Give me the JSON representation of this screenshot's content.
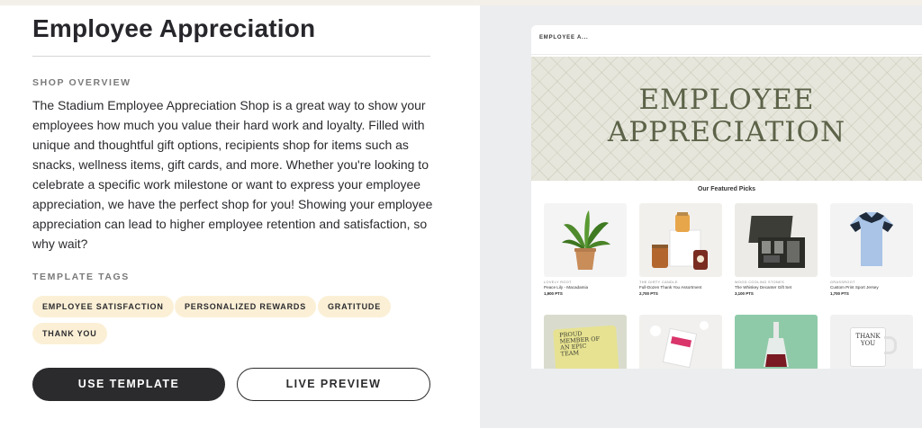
{
  "left": {
    "title": "Employee Appreciation",
    "overview_label": "SHOP OVERVIEW",
    "description": "The Stadium Employee Appreciation Shop is a great way to show your employees how much you value their hard work and loyalty. Filled with unique and thoughtful gift options, recipients shop for items such as snacks, wellness items, gift cards, and more. Whether you're looking to celebrate a specific work milestone or want to express your employee appreciation, we have the perfect shop for you! Showing your employee appreciation can lead to higher employee retention and satisfaction, so why wait?",
    "tags_label": "TEMPLATE TAGS",
    "tags": [
      "EMPLOYEE SATISFACTION",
      "PERSONALIZED REWARDS",
      "GRATITUDE",
      "THANK YOU"
    ],
    "use_template_label": "USE TEMPLATE",
    "live_preview_label": "LIVE PREVIEW"
  },
  "preview": {
    "tab_title": "EMPLOYEE A...",
    "hero_line1": "EMPLOYEE",
    "hero_line2": "APPRECIATION",
    "featured_title": "Our Featured Picks",
    "products": [
      {
        "brand": "LOVELY ROOT",
        "name": "Peace Lily - Macadamia",
        "points": "1,900 PTS"
      },
      {
        "brand": "THE DIRTY CANDLE",
        "name": "Full-Dozen Thank You Assortment",
        "points": "2,700 PTS"
      },
      {
        "brand": "WOOD COOLING STONES",
        "name": "The Whiskey Decanter Gift Set",
        "points": "3,100 PTS"
      },
      {
        "brand": "GRASSROOT",
        "name": "Custom Print Sport Jersey",
        "points": "1,700 PTS"
      }
    ],
    "second_row": [
      {
        "img_text": "PROUD MEMBER OF AN EPIC TEAM"
      },
      {
        "img_text": ""
      },
      {
        "img_text": ""
      },
      {
        "img_text": "THANK YOU"
      }
    ]
  }
}
